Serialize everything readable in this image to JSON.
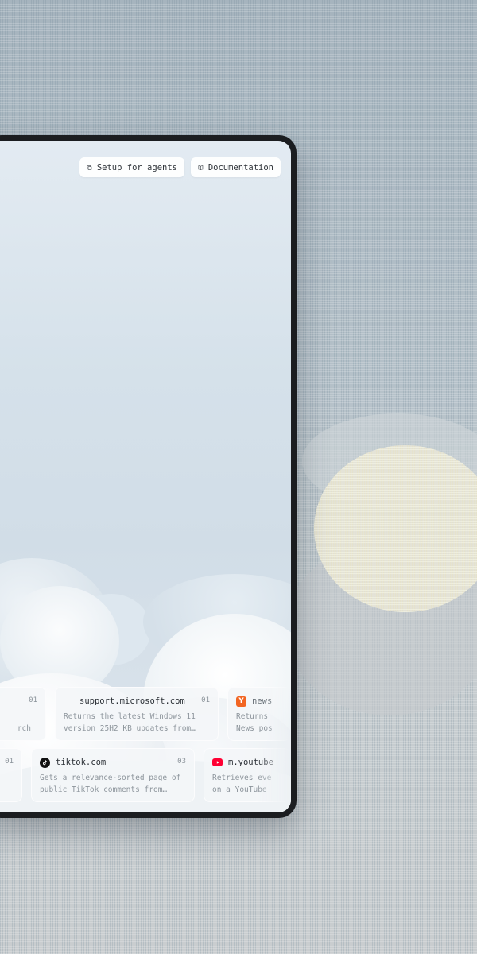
{
  "header": {
    "setup_label": "Setup for agents",
    "docs_label": "Documentation"
  },
  "cards_row1": [
    {
      "domain": "",
      "num": "01",
      "desc_line1": "",
      "desc_line2": "rch"
    },
    {
      "domain": "support.microsoft.com",
      "num": "01",
      "desc_line1": "Returns the latest Windows 11",
      "desc_line2": "version 25H2 KB updates from…",
      "icon": "microsoft-logo-icon"
    },
    {
      "domain": "news",
      "num": "",
      "desc_line1": "Returns",
      "desc_line2": "News pos",
      "icon": "ycombinator-logo-icon",
      "icon_letter": "Y"
    }
  ],
  "cards_row2": [
    {
      "domain": "",
      "num": "01",
      "desc_line1": "",
      "desc_line2": ""
    },
    {
      "domain": "tiktok.com",
      "num": "03",
      "desc_line1": "Gets a relevance-sorted page of",
      "desc_line2": "public TikTok comments from…",
      "icon": "tiktok-logo-icon"
    },
    {
      "domain": "m.youtube",
      "num": "",
      "desc_line1": "Retrieves eve",
      "desc_line2": "on a YouTube",
      "icon": "youtube-logo-icon"
    }
  ],
  "colors": {
    "ycombinator": "#f26522",
    "youtube": "#ff0033",
    "tiktok": "#111111"
  }
}
